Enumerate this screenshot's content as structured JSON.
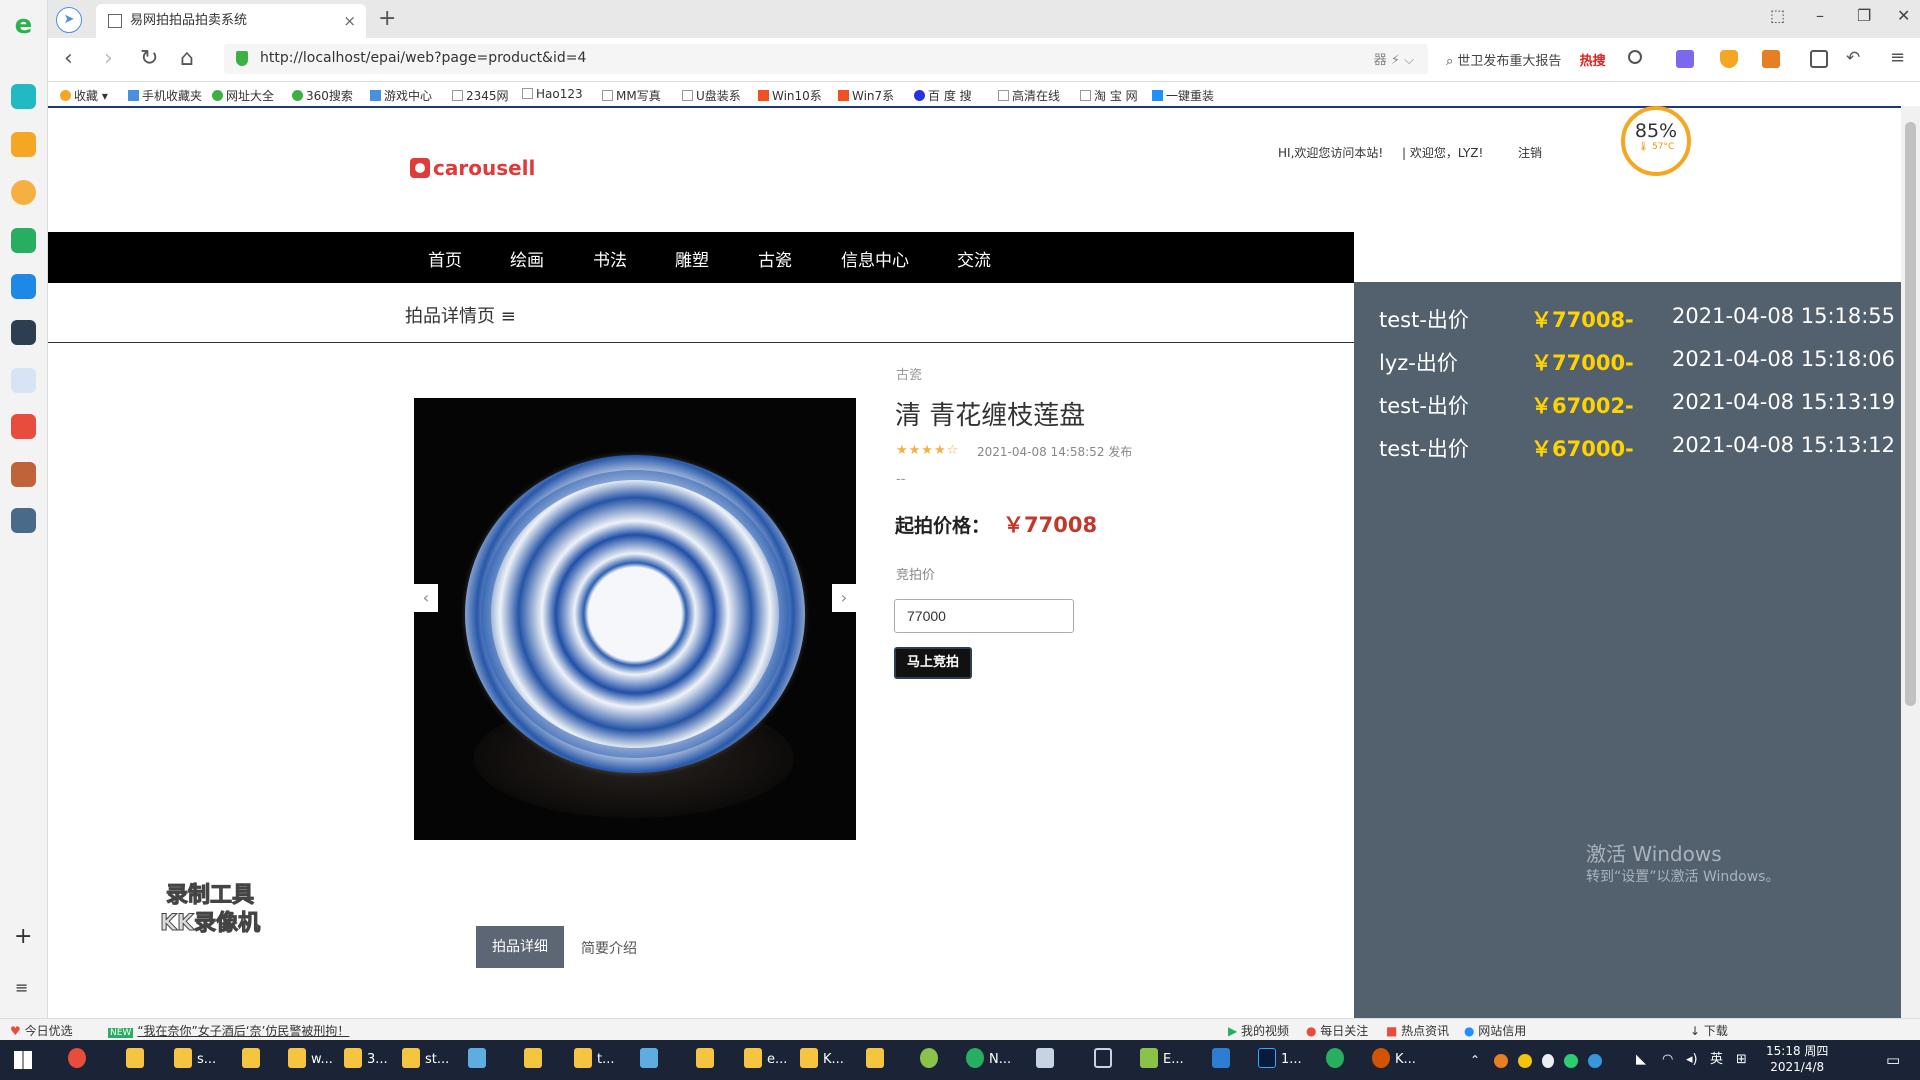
{
  "browser": {
    "tab_title": "易网拍拍品拍卖系统",
    "tab_close": "×",
    "new_tab": "+",
    "url": "http://localhost/epai/web?page=product&id=4",
    "url_right": "器  ⚡ ⌵",
    "search_hint": "世卫发布重大报告",
    "hot_label": "热搜",
    "nav_back": "‹",
    "nav_forward": "›",
    "nav_reload": "↻",
    "nav_home": "⌂",
    "win_min": "–",
    "win_max": "❐",
    "win_close": "✕",
    "win_pin": "⬚"
  },
  "bookmarks": [
    {
      "label": "收藏 ▾",
      "color": "#f5a623"
    },
    {
      "label": "手机收藏夹",
      "color": "#4a90e2"
    },
    {
      "label": "网址大全",
      "color": "#3cb043"
    },
    {
      "label": "360搜索",
      "color": "#3cb043"
    },
    {
      "label": "游戏中心",
      "color": "#4a90e2"
    },
    {
      "label": "2345网",
      "color": "#999999"
    },
    {
      "label": "Hao123",
      "color": "#999999"
    },
    {
      "label": "MM写真",
      "color": "#999999"
    },
    {
      "label": "U盘装系",
      "color": "#999999"
    },
    {
      "label": "Win10系",
      "color": "#f25022"
    },
    {
      "label": "Win7系",
      "color": "#f25022"
    },
    {
      "label": "百 度 搜",
      "color": "#2932e1"
    },
    {
      "label": "高清在线",
      "color": "#999999"
    },
    {
      "label": "淘 宝 网",
      "color": "#999999"
    },
    {
      "label": "一键重装",
      "color": "#1e90ff"
    }
  ],
  "site": {
    "logo_text": "carousell",
    "greeting": "HI,欢迎您访问本站!",
    "welcome": "| 欢迎您，LYZ!",
    "logout": "注销"
  },
  "gauge": {
    "percent": "85%",
    "temp": "🌡 57°C"
  },
  "nav": [
    "首页",
    "绘画",
    "书法",
    "雕塑",
    "古瓷",
    "信息中心",
    "交流"
  ],
  "breadcrumb": "拍品详情页  ≡",
  "product": {
    "category": "古瓷",
    "title": "清 青花缠枝莲盘",
    "rating_stars": "★★★★☆",
    "rating_value": 4,
    "published": "2021-04-08 14:58:52 发布",
    "description": "--",
    "price_label": "起拍价格：",
    "price_value": "￥77008",
    "bid_label": "竞拍价",
    "bid_input_value": "77000",
    "bid_button": "马上竞拍",
    "carousel_prev": "‹",
    "carousel_next": "›"
  },
  "tabs": {
    "detail": "拍品详细",
    "intro": "简要介绍"
  },
  "watermark": {
    "line1": "录制工具",
    "line2": "KK录像机"
  },
  "bids": [
    {
      "user": "test-出价",
      "amount": "￥77008-",
      "time": "2021-04-08 15:18:55"
    },
    {
      "user": "lyz-出价",
      "amount": "￥77000-",
      "time": "2021-04-08 15:18:06"
    },
    {
      "user": "test-出价",
      "amount": "￥67002-",
      "time": "2021-04-08 15:13:19"
    },
    {
      "user": "test-出价",
      "amount": "￥67000-",
      "time": "2021-04-08 15:13:12"
    }
  ],
  "activation": {
    "title": "激活 Windows",
    "subtitle": "转到“设置”以激活 Windows。"
  },
  "statusbar": {
    "left1": "今日优选",
    "left2": "“我在奈你”女子酒后‘奈’仿民警被刑拘！",
    "new_badge": "NEW",
    "right": [
      "我的视频",
      "每日关注",
      "热点资讯",
      "网站信用",
      "下载"
    ]
  },
  "taskbar": {
    "items": [
      "s...",
      "w...",
      "3...",
      "st...",
      "t...",
      "e...",
      "K...",
      "N...",
      "E...",
      "1...",
      "K..."
    ],
    "time": "15:18 周四",
    "date": "2021/4/8",
    "ime": "英"
  }
}
